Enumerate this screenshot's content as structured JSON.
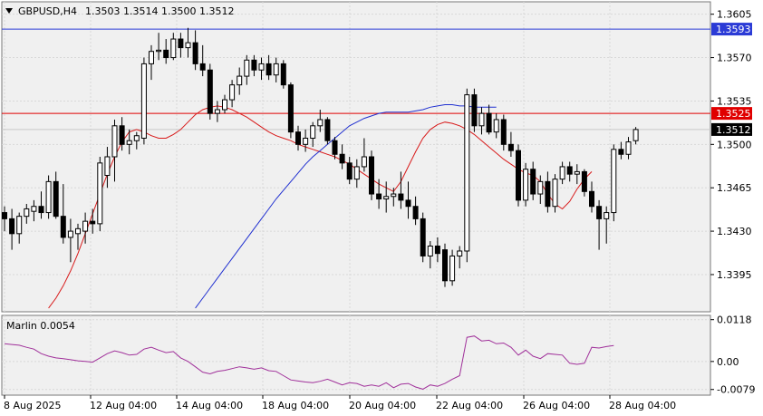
{
  "header": {
    "symbol_label": "GBPUSD,H4",
    "ohlc": "1.3503 1.3514 1.3500 1.3512"
  },
  "indicator": {
    "label": "Marlin 0.0054"
  },
  "colors": {
    "background": "#ffffff",
    "plot_background": "#f0f0f0",
    "grid": "#d8d8d8",
    "blue_level": "#2b3bd6",
    "red_level": "#e00000",
    "slow_ma": "#1f2fd0",
    "fast_ma": "#d81a1a",
    "oscillator": "#a0309a",
    "candle": "#000000",
    "current_price_bg": "#000000"
  },
  "chart_data": [
    {
      "type": "candlestick",
      "title": "GBPUSD,H4",
      "ylim": [
        1.3365,
        1.3615
      ],
      "y_ticks": [
        "1.3605",
        "1.3570",
        "1.3535",
        "1.3500",
        "1.3465",
        "1.3430",
        "1.3395"
      ],
      "x_ticks": [
        "8 Aug 2025",
        "12 Aug 04:00",
        "14 Aug 04:00",
        "18 Aug 04:00",
        "20 Aug 04:00",
        "22 Aug 04:00",
        "26 Aug 04:00",
        "28 Aug 04:00"
      ],
      "grid": true,
      "price_labels": [
        {
          "name": "blue-level",
          "value": 1.3593,
          "text": "1.3593"
        },
        {
          "name": "red-level",
          "value": 1.3525,
          "text": "1.3525"
        },
        {
          "name": "current-price",
          "value": 1.3512,
          "text": "1.3512"
        }
      ],
      "candles": [
        [
          1.3445,
          1.345,
          1.343,
          1.344
        ],
        [
          1.344,
          1.3448,
          1.3415,
          1.3428
        ],
        [
          1.3428,
          1.3445,
          1.342,
          1.3442
        ],
        [
          1.3442,
          1.3452,
          1.3436,
          1.3448
        ],
        [
          1.3446,
          1.3455,
          1.3438,
          1.345
        ],
        [
          1.345,
          1.3462,
          1.344,
          1.3445
        ],
        [
          1.3445,
          1.3475,
          1.344,
          1.347
        ],
        [
          1.347,
          1.3478,
          1.344,
          1.3442
        ],
        [
          1.3442,
          1.3468,
          1.342,
          1.3425
        ],
        [
          1.3425,
          1.344,
          1.3405,
          1.343
        ],
        [
          1.3428,
          1.3436,
          1.3415,
          1.3432
        ],
        [
          1.343,
          1.3445,
          1.342,
          1.3438
        ],
        [
          1.3438,
          1.3448,
          1.3428,
          1.3436
        ],
        [
          1.3436,
          1.349,
          1.343,
          1.3485
        ],
        [
          1.3475,
          1.3498,
          1.3465,
          1.349
        ],
        [
          1.349,
          1.352,
          1.347,
          1.3515
        ],
        [
          1.3515,
          1.3522,
          1.3495,
          1.35
        ],
        [
          1.35,
          1.3512,
          1.3492,
          1.3503
        ],
        [
          1.3503,
          1.351,
          1.3496,
          1.3507
        ],
        [
          1.3505,
          1.357,
          1.35,
          1.3565
        ],
        [
          1.3565,
          1.358,
          1.3552,
          1.3575
        ],
        [
          1.3575,
          1.359,
          1.3568,
          1.3576
        ],
        [
          1.3576,
          1.3585,
          1.3565,
          1.357
        ],
        [
          1.357,
          1.359,
          1.3568,
          1.3585
        ],
        [
          1.3585,
          1.359,
          1.357,
          1.3578
        ],
        [
          1.3578,
          1.3594,
          1.357,
          1.3582
        ],
        [
          1.3582,
          1.3592,
          1.356,
          1.3565
        ],
        [
          1.3565,
          1.358,
          1.3555,
          1.356
        ],
        [
          1.356,
          1.3565,
          1.352,
          1.3525
        ],
        [
          1.3525,
          1.3535,
          1.3518,
          1.3528
        ],
        [
          1.3528,
          1.354,
          1.3525,
          1.3536
        ],
        [
          1.3536,
          1.3552,
          1.353,
          1.3548
        ],
        [
          1.3548,
          1.3562,
          1.354,
          1.3555
        ],
        [
          1.3555,
          1.3572,
          1.3548,
          1.3568
        ],
        [
          1.3568,
          1.3572,
          1.3555,
          1.356
        ],
        [
          1.356,
          1.357,
          1.3552,
          1.3565
        ],
        [
          1.3565,
          1.3572,
          1.3552,
          1.3556
        ],
        [
          1.3556,
          1.357,
          1.355,
          1.3565
        ],
        [
          1.3565,
          1.3568,
          1.3545,
          1.3548
        ],
        [
          1.3548,
          1.355,
          1.3505,
          1.351
        ],
        [
          1.351,
          1.3515,
          1.3495,
          1.35
        ],
        [
          1.35,
          1.3512,
          1.3494,
          1.3505
        ],
        [
          1.3505,
          1.3518,
          1.3498,
          1.3515
        ],
        [
          1.3515,
          1.3528,
          1.351,
          1.352
        ],
        [
          1.352,
          1.3522,
          1.35,
          1.3503
        ],
        [
          1.3503,
          1.3506,
          1.3488,
          1.3492
        ],
        [
          1.3492,
          1.35,
          1.348,
          1.3485
        ],
        [
          1.3485,
          1.349,
          1.3468,
          1.3472
        ],
        [
          1.3472,
          1.3488,
          1.3465,
          1.3482
        ],
        [
          1.3482,
          1.3505,
          1.3478,
          1.349
        ],
        [
          1.349,
          1.3495,
          1.3455,
          1.346
        ],
        [
          1.346,
          1.3472,
          1.3448,
          1.3456
        ],
        [
          1.3456,
          1.347,
          1.3445,
          1.3458
        ],
        [
          1.3458,
          1.3465,
          1.345,
          1.346
        ],
        [
          1.346,
          1.3478,
          1.3448,
          1.3455
        ],
        [
          1.3455,
          1.347,
          1.344,
          1.345
        ],
        [
          1.345,
          1.3458,
          1.3435,
          1.344
        ],
        [
          1.344,
          1.3445,
          1.3405,
          1.341
        ],
        [
          1.341,
          1.3422,
          1.34,
          1.3418
        ],
        [
          1.3418,
          1.3425,
          1.3405,
          1.3412
        ],
        [
          1.3415,
          1.342,
          1.3385,
          1.339
        ],
        [
          1.339,
          1.3415,
          1.3386,
          1.341
        ],
        [
          1.341,
          1.3418,
          1.34,
          1.3414
        ],
        [
          1.3414,
          1.3545,
          1.3405,
          1.354
        ],
        [
          1.354,
          1.3545,
          1.351,
          1.3515
        ],
        [
          1.3515,
          1.353,
          1.3508,
          1.3525
        ],
        [
          1.3525,
          1.3532,
          1.3508,
          1.351
        ],
        [
          1.351,
          1.3525,
          1.3505,
          1.352
        ],
        [
          1.352,
          1.3524,
          1.3495,
          1.35
        ],
        [
          1.35,
          1.351,
          1.349,
          1.3495
        ],
        [
          1.3495,
          1.35,
          1.345,
          1.3455
        ],
        [
          1.3455,
          1.3485,
          1.345,
          1.348
        ],
        [
          1.348,
          1.3486,
          1.3455,
          1.346
        ],
        [
          1.346,
          1.3475,
          1.3452,
          1.347
        ],
        [
          1.347,
          1.3478,
          1.3445,
          1.345
        ],
        [
          1.345,
          1.3476,
          1.3445,
          1.3472
        ],
        [
          1.3472,
          1.3486,
          1.3468,
          1.3482
        ],
        [
          1.3482,
          1.3486,
          1.347,
          1.3476
        ],
        [
          1.3476,
          1.3484,
          1.3468,
          1.3478
        ],
        [
          1.3478,
          1.348,
          1.3458,
          1.3462
        ],
        [
          1.3462,
          1.347,
          1.3445,
          1.345
        ],
        [
          1.345,
          1.3455,
          1.3415,
          1.344
        ],
        [
          1.344,
          1.345,
          1.342,
          1.3445
        ],
        [
          1.3445,
          1.35,
          1.3438,
          1.3496
        ],
        [
          1.3496,
          1.3502,
          1.3488,
          1.3492
        ],
        [
          1.3492,
          1.3506,
          1.3488,
          1.3502
        ],
        [
          1.3503,
          1.3514,
          1.35,
          1.3512
        ]
      ],
      "series": [
        {
          "values": [
            1.335,
            1.3352,
            1.3354,
            1.3356,
            1.3358,
            1.3362,
            1.3368,
            1.3376,
            1.3386,
            1.3398,
            1.3412,
            1.3428,
            1.3444,
            1.346,
            1.3476,
            1.349,
            1.3502,
            1.351,
            1.3512,
            1.351,
            1.3507,
            1.3505,
            1.3505,
            1.3508,
            1.3512,
            1.3518,
            1.3524,
            1.3528,
            1.353,
            1.3531,
            1.353,
            1.3528,
            1.3525,
            1.3522,
            1.3518,
            1.3514,
            1.351,
            1.3507,
            1.3505,
            1.3503,
            1.35,
            1.3498,
            1.3496,
            1.3494,
            1.3492,
            1.349,
            1.3487,
            1.3484,
            1.348,
            1.3476,
            1.3472,
            1.3468,
            1.3465,
            1.3462,
            1.347,
            1.3482,
            1.3494,
            1.3505,
            1.3512,
            1.3516,
            1.3518,
            1.3517,
            1.3515,
            1.3512,
            1.3508,
            1.3503,
            1.3498,
            1.3493,
            1.3488,
            1.3484,
            1.348,
            1.3477,
            1.3475,
            1.347,
            1.346,
            1.3452,
            1.3448,
            1.3454,
            1.3464,
            1.3472,
            1.3478
          ]
        },
        {
          "values": [
            1.332,
            1.3328,
            1.3336,
            1.3344,
            1.3352,
            1.336,
            1.3368,
            1.3376,
            1.3384,
            1.3392,
            1.34,
            1.3408,
            1.3416,
            1.3424,
            1.3432,
            1.344,
            1.3448,
            1.3456,
            1.3463,
            1.347,
            1.3477,
            1.3484,
            1.349,
            1.3495,
            1.35,
            1.3505,
            1.351,
            1.3515,
            1.3518,
            1.3521,
            1.3523,
            1.3525,
            1.3526,
            1.3526,
            1.3526,
            1.3526,
            1.3527,
            1.3528,
            1.353,
            1.3531,
            1.3532,
            1.3532,
            1.3531,
            1.3531,
            1.353,
            1.353,
            1.353,
            1.353
          ]
        },
        {
          "name": "Marlin",
          "values": [
            0.005,
            0.0048,
            0.0046,
            0.004,
            0.0035,
            0.0022,
            0.0015,
            0.001,
            0.0008,
            0.0005,
            0.0002,
            0.0,
            -0.0002,
            0.001,
            0.0022,
            0.003,
            0.0025,
            0.0018,
            0.002,
            0.0035,
            0.004,
            0.0032,
            0.0025,
            0.0028,
            0.001,
            0.0,
            -0.0015,
            -0.003,
            -0.0035,
            -0.0028,
            -0.0025,
            -0.002,
            -0.0015,
            -0.0018,
            -0.0022,
            -0.0018,
            -0.0026,
            -0.0028,
            -0.004,
            -0.0052,
            -0.0055,
            -0.0058,
            -0.006,
            -0.0056,
            -0.005,
            -0.0058,
            -0.0066,
            -0.006,
            -0.0062,
            -0.007,
            -0.0066,
            -0.007,
            -0.006,
            -0.0074,
            -0.0064,
            -0.0062,
            -0.0072,
            -0.0078,
            -0.0066,
            -0.007,
            -0.0062,
            -0.005,
            -0.004,
            0.0068,
            0.0072,
            0.0058,
            0.006,
            0.005,
            0.0052,
            0.004,
            0.0018,
            0.0032,
            0.0015,
            0.0008,
            0.0022,
            0.002,
            0.0018,
            -0.0005,
            -0.0008,
            -0.0005,
            0.004,
            0.0038,
            0.0042,
            0.0045
          ]
        }
      ]
    },
    {
      "type": "line",
      "title": "Marlin 0.0054",
      "ylim": [
        -0.0095,
        0.013
      ],
      "y_ticks": [
        "0.0118",
        "0.00",
        "-0.0079"
      ],
      "series": []
    }
  ]
}
